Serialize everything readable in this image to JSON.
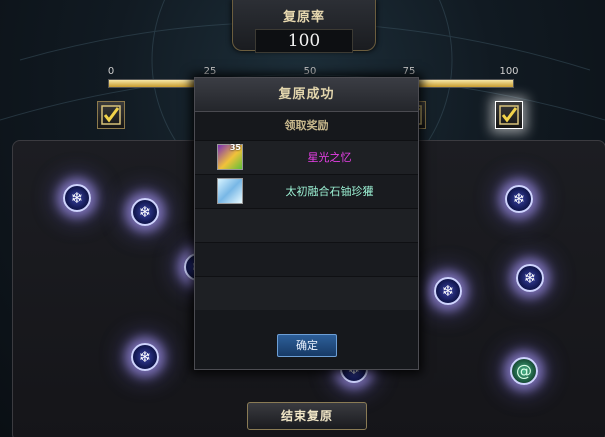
{
  "rate_panel": {
    "title": "复原率",
    "value": "100"
  },
  "progress": {
    "fraction": 1.0,
    "ticks": [
      "0",
      "25",
      "50",
      "75",
      "100"
    ]
  },
  "milestones": [
    {
      "icon": "check-icon",
      "state": "claimed"
    },
    {
      "icon": "check-icon",
      "state": "claimed"
    },
    {
      "icon": "check-icon",
      "state": "claimed"
    },
    {
      "icon": "check-icon",
      "state": "claimed"
    },
    {
      "icon": "check-icon",
      "state": "claimed-highlighted"
    }
  ],
  "dialog": {
    "title": "复原成功",
    "subtitle": "领取奖励",
    "rewards": [
      {
        "name": "星光之忆",
        "count": "35",
        "icon": "starlight-memory-icon",
        "color": "#e83fe8"
      },
      {
        "name": "太初融合石铀珍獾",
        "count": "",
        "icon": "crystal-icon",
        "color": "#9bf0d3"
      }
    ],
    "confirm_label": "确定"
  },
  "end_button_label": "结束复原",
  "colors": {
    "accent_gold": "#c79b2f",
    "node_glow": "#b0a0ff",
    "confirm_blue": "#2d5f99"
  }
}
